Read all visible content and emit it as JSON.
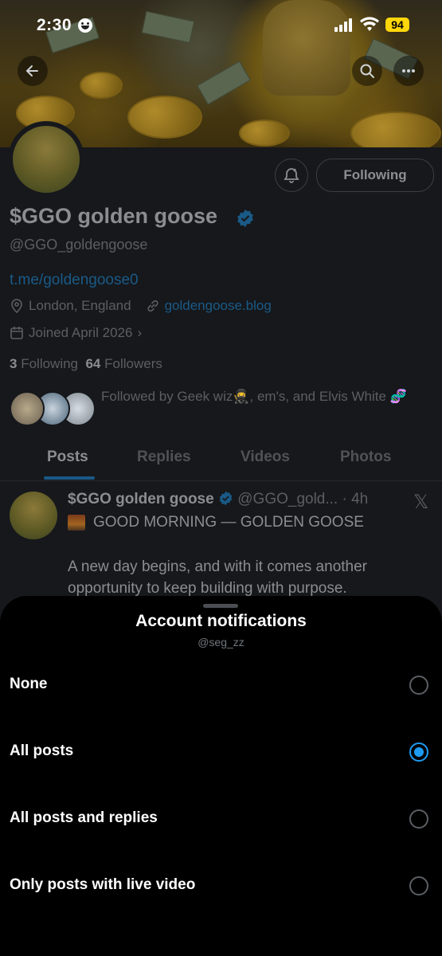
{
  "status_bar": {
    "time": "2:30",
    "battery": "94"
  },
  "profile": {
    "name": "$GGO golden goose",
    "handle": "@GGO_goldengoose",
    "link": "t.me/goldengoose0",
    "location": "London, England",
    "website": "goldengoose.blog",
    "joined": "Joined April 2026",
    "following_count": "3",
    "following_label": "Following",
    "followers_count": "64",
    "followers_label": "Followers",
    "followed_by": "Followed by Geek wiz🥷, em's, and Elvis White 🧬",
    "follow_button": "Following"
  },
  "tabs": [
    {
      "label": "Posts",
      "active": true
    },
    {
      "label": "Replies"
    },
    {
      "label": "Videos"
    },
    {
      "label": "Photos"
    }
  ],
  "post": {
    "author": "$GGO golden goose",
    "handle_time": "@GGO_gold... · 4h",
    "headline": "GOOD MORNING — GOLDEN GOOSE",
    "body": "A new day begins, and with it comes another opportunity to keep building with purpose."
  },
  "sheet": {
    "title": "Account notifications",
    "subtitle": "@seg_zz",
    "options": [
      {
        "label": "None",
        "selected": false
      },
      {
        "label": "All posts",
        "selected": true
      },
      {
        "label": "All posts and replies",
        "selected": false
      },
      {
        "label": "Only posts with live video",
        "selected": false
      }
    ]
  },
  "colors": {
    "accent": "#1d9bf0",
    "sheet_bg": "#000000",
    "battery": "#ffd60a"
  },
  "icons": [
    "back-arrow-icon",
    "search-icon",
    "more-icon",
    "bell-icon",
    "verified-badge-icon",
    "location-icon",
    "link-icon",
    "calendar-icon",
    "x-logo-icon"
  ]
}
